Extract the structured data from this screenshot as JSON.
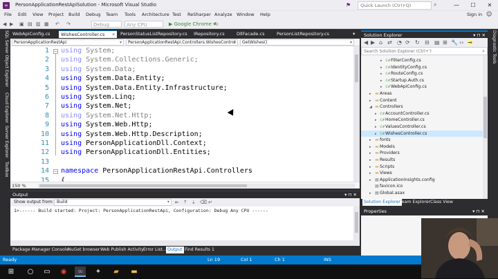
{
  "window": {
    "title": "PersonApplicationRestApiSolution - Microsoft Visual Studio",
    "quick_launch_placeholder": "Quick Launch (Ctrl+Q)",
    "minimize": "—",
    "maximize": "☐",
    "close": "✕"
  },
  "menu": {
    "items": [
      "File",
      "Edit",
      "View",
      "Project",
      "Build",
      "Debug",
      "Team",
      "Tools",
      "Architecture",
      "Test",
      "ReSharper",
      "Analyze",
      "Window",
      "Help"
    ],
    "sign_in": "Sign in"
  },
  "toolbar": {
    "config": "Debug",
    "platform": "Any CPU",
    "start": "▶ Google Chrome ▾"
  },
  "left_rail": [
    "SQL Server Object Explorer",
    "Cloud Explorer",
    "Server Explorer",
    "Toolbox"
  ],
  "right_rail": [
    "Diagnostic Tools"
  ],
  "doc_tabs": [
    {
      "label": "WebApiConfig.cs",
      "active": false
    },
    {
      "label": "WishesController.cs",
      "active": true
    },
    {
      "label": "PersonStatusListRepository.cs",
      "active": false
    },
    {
      "label": "IRepository.cs",
      "active": false
    },
    {
      "label": "DllFacade.cs",
      "active": false
    },
    {
      "label": "PersonListRepository.cs",
      "active": false
    }
  ],
  "nav": {
    "project": "PersonApplicationRestApi",
    "type": "PersonApplicationRestApi.Controllers.WishesControl",
    "member": "GetWishes()"
  },
  "code": {
    "line_numbers": [
      "1",
      "2",
      "3",
      "4",
      "5",
      "6",
      "7",
      "8",
      "9",
      "10",
      "11",
      "12",
      "13",
      "14",
      "15"
    ],
    "lines": [
      {
        "kw": "using",
        "rest": " System;",
        "dim": true
      },
      {
        "kw": "using",
        "rest": " System.Collections.Generic;",
        "dim": true
      },
      {
        "kw": "using",
        "rest": " System.Data;",
        "dim": true
      },
      {
        "kw": "using",
        "rest": " System.Data.Entity;",
        "dim": false
      },
      {
        "kw": "using",
        "rest": " System.Data.Entity.Infrastructure;",
        "dim": false
      },
      {
        "kw": "using",
        "rest": " System.Linq;",
        "dim": false
      },
      {
        "kw": "using",
        "rest": " System.Net;",
        "dim": false
      },
      {
        "kw": "using",
        "rest": " System.Net.Http;",
        "dim": true
      },
      {
        "kw": "using",
        "rest": " System.Web.Http;",
        "dim": false
      },
      {
        "kw": "using",
        "rest": " System.Web.Http.Description;",
        "dim": false
      },
      {
        "kw": "using",
        "rest": " PersonApplicationDll.Context;",
        "dim": false
      },
      {
        "kw": "using",
        "rest": " PersonApplicationDll.Entities;",
        "dim": false
      },
      {
        "kw": "",
        "rest": "",
        "dim": false
      },
      {
        "kw": "namespace",
        "rest": " PersonApplicationRestApi.Controllers",
        "dim": false
      },
      {
        "kw": "",
        "rest": "{",
        "dim": false
      }
    ]
  },
  "zoom": "150 %",
  "solution_explorer": {
    "title": "Solution Explorer",
    "search_placeholder": "Search Solution Explorer (Ctrl+')",
    "items": [
      {
        "label": "FilterConfig.cs",
        "kind": "cs",
        "level": 3,
        "expander": "▸"
      },
      {
        "label": "IdentityConfig.cs",
        "kind": "cs",
        "level": 3,
        "expander": "▸"
      },
      {
        "label": "RouteConfig.cs",
        "kind": "cs",
        "level": 3,
        "expander": "▸"
      },
      {
        "label": "Startup.Auth.cs",
        "kind": "cs",
        "level": 3,
        "expander": "▸"
      },
      {
        "label": "WebApiConfig.cs",
        "kind": "cs",
        "level": 3,
        "expander": "▸"
      },
      {
        "label": "Areas",
        "kind": "folder",
        "level": 1,
        "expander": "▸"
      },
      {
        "label": "Content",
        "kind": "folder",
        "level": 1,
        "expander": "▸"
      },
      {
        "label": "Controllers",
        "kind": "folder",
        "level": 1,
        "expander": "◢"
      },
      {
        "label": "AccountController.cs",
        "kind": "cs",
        "level": 2,
        "expander": "▸"
      },
      {
        "label": "HomeController.cs",
        "kind": "cs",
        "level": 2,
        "expander": "▸"
      },
      {
        "label": "ValuesController.cs",
        "kind": "cs",
        "level": 2,
        "expander": "▸"
      },
      {
        "label": "WishesController.cs",
        "kind": "cs",
        "level": 2,
        "expander": "▸",
        "selected": true
      },
      {
        "label": "fonts",
        "kind": "folder",
        "level": 1,
        "expander": "▸"
      },
      {
        "label": "Models",
        "kind": "folder",
        "level": 1,
        "expander": "▸"
      },
      {
        "label": "Providers",
        "kind": "folder",
        "level": 1,
        "expander": "▸"
      },
      {
        "label": "Results",
        "kind": "folder",
        "level": 1,
        "expander": "▸"
      },
      {
        "label": "Scripts",
        "kind": "folder",
        "level": 1,
        "expander": "▸"
      },
      {
        "label": "Views",
        "kind": "folder",
        "level": 1,
        "expander": "▸"
      },
      {
        "label": "ApplicationInsights.config",
        "kind": "cfg",
        "level": 1,
        "expander": "▸"
      },
      {
        "label": "favicon.ico",
        "kind": "cfg",
        "level": 1,
        "expander": ""
      },
      {
        "label": "Global.asax",
        "kind": "cfg",
        "level": 1,
        "expander": "▸"
      }
    ],
    "tabs": [
      {
        "label": "Solution Explorer",
        "active": true
      },
      {
        "label": "Team Explorer",
        "active": false
      },
      {
        "label": "Class View",
        "active": false
      }
    ]
  },
  "properties": {
    "title": "Properties"
  },
  "output": {
    "title": "Output",
    "show_from_label": "Show output from:",
    "source": "Build",
    "text": "1>------ Build started: Project: PersonApplicationRestApi, Configuration: Debug Any CPU ------"
  },
  "bottom_tabs": [
    {
      "label": "Package Manager Console",
      "active": false
    },
    {
      "label": "NuGet browser",
      "active": false
    },
    {
      "label": "Web Publish Activity",
      "active": false
    },
    {
      "label": "Error List...",
      "active": false
    },
    {
      "label": "Output",
      "active": true
    },
    {
      "label": "Find Results 1",
      "active": false
    }
  ],
  "status": {
    "state": "Ready",
    "ln": "Ln 19",
    "col": "Col 1",
    "ch": "Ch 1",
    "mode": "INS"
  },
  "colors": {
    "accent": "#007acc",
    "brand": "#68217a",
    "keyword": "#0000ff",
    "line_number": "#2b91af"
  }
}
